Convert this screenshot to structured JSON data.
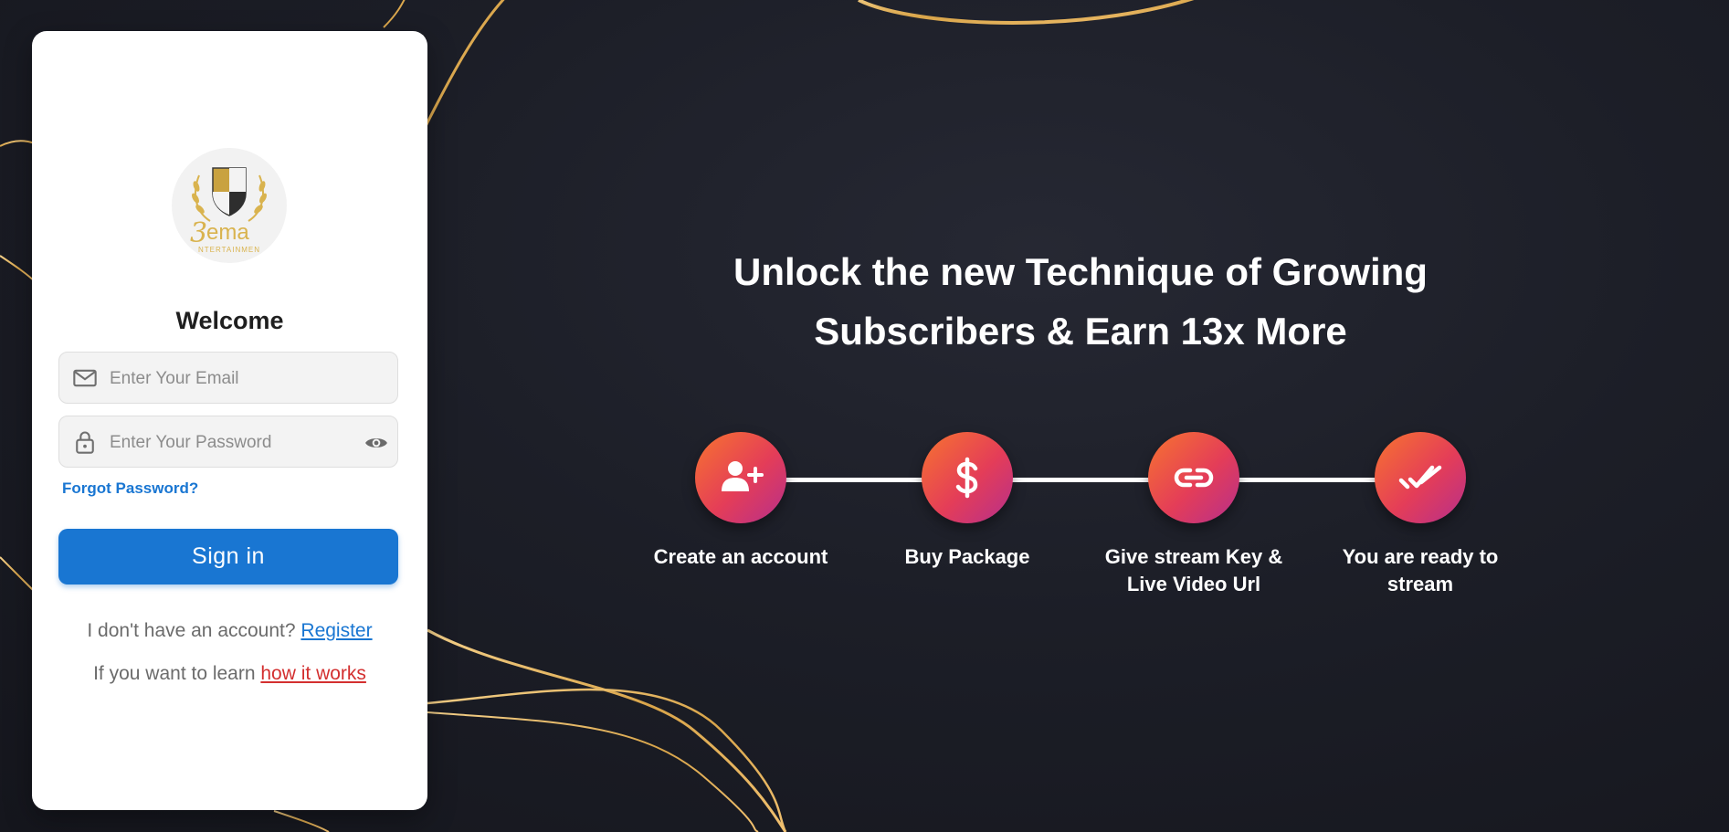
{
  "login": {
    "title": "Welcome",
    "email_placeholder": "Enter Your Email",
    "password_placeholder": "Enter Your Password",
    "forgot_password": "Forgot Password?",
    "sign_in": "Sign in",
    "register_prompt": "I don't have an account?",
    "register_link": "Register",
    "learn_prompt": "If you want to learn",
    "learn_link": "how it works"
  },
  "logo": {
    "text": "ema",
    "subtext": "NTERTAINMEN"
  },
  "hero": {
    "headline_line1": "Unlock the new Technique of Growing",
    "headline_line2": "Subscribers & Earn 13x More",
    "steps": [
      {
        "label": "Create an account",
        "icon": "add-user-icon"
      },
      {
        "label": "Buy Package",
        "icon": "dollar-icon"
      },
      {
        "label": "Give stream Key & Live Video Url",
        "icon": "link-icon"
      },
      {
        "label": "You are ready to stream",
        "icon": "double-check-icon"
      }
    ]
  },
  "colors": {
    "primary": "#1976d2",
    "link_red": "#d32f2f",
    "step_gradient_start": "#f7742f",
    "step_gradient_end": "#b62f8c",
    "background": "#1c1e27",
    "gold": "#d9a54a"
  }
}
